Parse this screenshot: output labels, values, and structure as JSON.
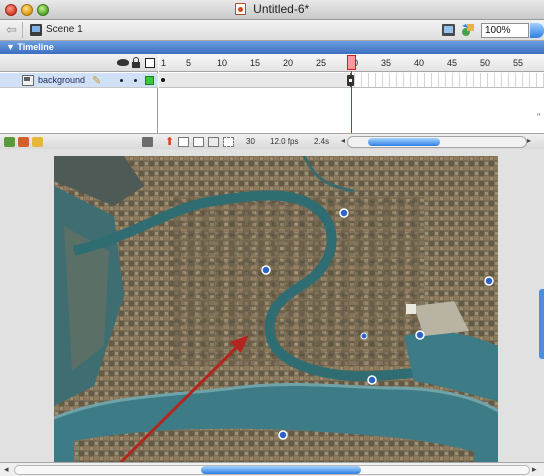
{
  "window": {
    "title": "Untitled-6*"
  },
  "editbar": {
    "scene_label": "Scene 1",
    "zoom_value": "100%"
  },
  "timeline": {
    "header": "▼ Timeline",
    "ruler_numbers": [
      "1",
      "5",
      "10",
      "15",
      "20",
      "25",
      "30",
      "35",
      "40",
      "45",
      "50",
      "55"
    ],
    "layer_name": "background",
    "current_frame": "30",
    "frame_rate": "12.0 fps",
    "elapsed_time": "2.4s"
  },
  "stage": {
    "content": "aerial-map-venice",
    "annotation_arrow_color": "#b3261e"
  },
  "colors": {
    "accent": "#2e7fe3",
    "outline_color": "#3cc83c",
    "playhead": "#e11b1b"
  }
}
